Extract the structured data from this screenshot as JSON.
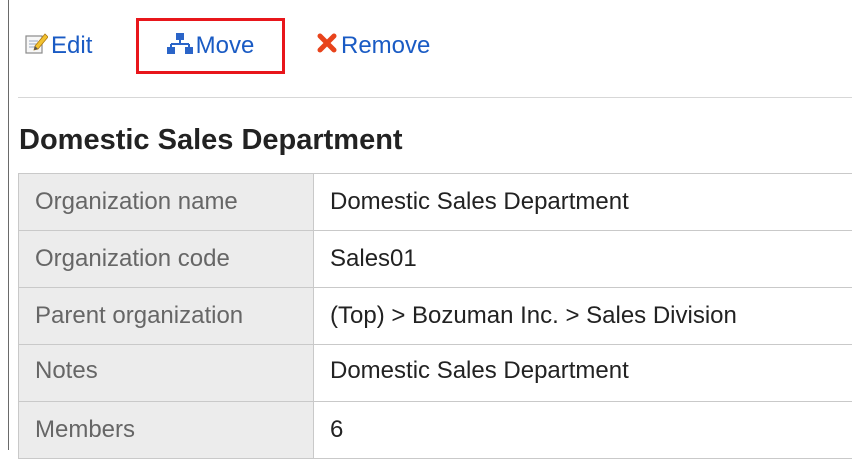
{
  "toolbar": {
    "edit_label": "Edit",
    "move_label": "Move",
    "remove_label": "Remove"
  },
  "colors": {
    "link": "#1a5bc4",
    "highlight_border": "#e8161b",
    "remove_icon": "#e8431b",
    "label_bg": "#ececec"
  },
  "icons": {
    "edit": "edit-icon",
    "move": "org-tree-icon",
    "remove": "remove-x-icon"
  },
  "section": {
    "title": "Domestic Sales Department"
  },
  "details": {
    "rows": [
      {
        "label": "Organization name",
        "value": "Domestic Sales Department"
      },
      {
        "label": "Organization code",
        "value": "Sales01"
      },
      {
        "label": "Parent organization",
        "value": "(Top) > Bozuman Inc. > Sales Division"
      },
      {
        "label": "Notes",
        "value": "Domestic Sales Department"
      },
      {
        "label": "Members",
        "value": "6"
      }
    ]
  }
}
